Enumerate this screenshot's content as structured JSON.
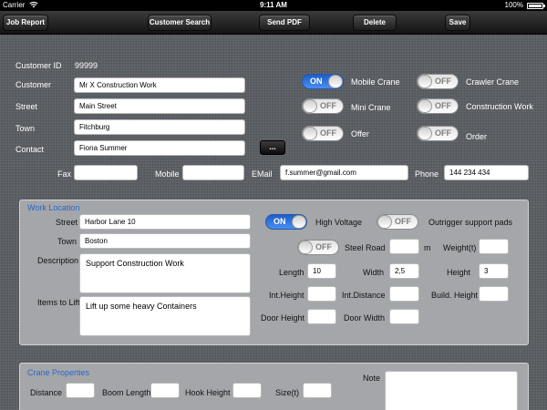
{
  "status_bar": {
    "carrier": "Carrier",
    "wifi_icon": "wifi-icon",
    "time": "9:11 AM",
    "battery": "100%"
  },
  "toolbar": {
    "job_report": "Job Report",
    "customer_search": "Customer Search",
    "send_pdf": "Send PDF",
    "delete": "Delete",
    "save": "Save"
  },
  "customer": {
    "id_label": "Customer ID",
    "id_value": "99999",
    "customer_label": "Customer",
    "customer_value": "Mr X Construction Work",
    "street_label": "Street",
    "street_value": "Main Street",
    "town_label": "Town",
    "town_value": "Fitchburg",
    "contact_label": "Contact",
    "contact_value": "Fiona Summer",
    "contact_more": "...",
    "fax_label": "Fax",
    "fax_value": "",
    "mobile_label": "Mobile",
    "mobile_value": "",
    "email_label": "EMail",
    "email_value": "f.summer@gmail.com",
    "phone_label": "Phone",
    "phone_value": "144 234 434"
  },
  "options": {
    "mobile_crane": {
      "label": "Mobile Crane",
      "state": "ON"
    },
    "crawler_crane": {
      "label": "Crawler Crane",
      "state": "OFF"
    },
    "mini_crane": {
      "label": "Mini Crane",
      "state": "OFF"
    },
    "construction_work": {
      "label": "Construction Work",
      "state": "OFF"
    },
    "offer": {
      "label": "Offer",
      "state": "OFF"
    },
    "order": {
      "label": "Order",
      "state": "OFF"
    }
  },
  "work_location": {
    "title": "Work Location",
    "street_label": "Street",
    "street_value": "Harbor Lane 10",
    "town_label": "Town",
    "town_value": "Boston",
    "description_label": "Description",
    "description_value": "Support Construction Work",
    "items_label": "Items to Lift",
    "items_value": "Lift up some heavy Containers",
    "high_voltage": {
      "label": "High Voltage",
      "state": "ON"
    },
    "outrigger": {
      "label": "Outrigger support pads",
      "state": "OFF"
    },
    "steel_road": {
      "label": "Steel Road",
      "state": "OFF"
    },
    "steel_road_value": "",
    "steel_road_unit": "m",
    "weight_label": "Weight(t)",
    "weight_value": "",
    "length_label": "Length",
    "length_value": "10",
    "width_label": "Width",
    "width_value": "2,5",
    "height_label": "Height",
    "height_value": "3",
    "int_height_label": "Int.Height",
    "int_height_value": "",
    "int_distance_label": "Int.Distance",
    "int_distance_value": "",
    "build_height_label": "Build. Height",
    "build_height_value": "",
    "door_height_label": "Door Height",
    "door_height_value": "",
    "door_width_label": "Door Width",
    "door_width_value": ""
  },
  "crane_properties": {
    "title": "Crane Properties",
    "distance_label": "Distance",
    "distance_value": "",
    "boom_length_label": "Boom Length",
    "boom_length_value": "",
    "hook_height_label": "Hook Height",
    "hook_height_value": "",
    "size_label": "Size(t)",
    "size_value": "",
    "note_label": "Note",
    "note_value": ""
  },
  "colors": {
    "accent": "#2a67c9",
    "toggle_on": "#2f6fdc",
    "panel": "#a4a6a9",
    "toolbar": "#1e1e1e"
  }
}
